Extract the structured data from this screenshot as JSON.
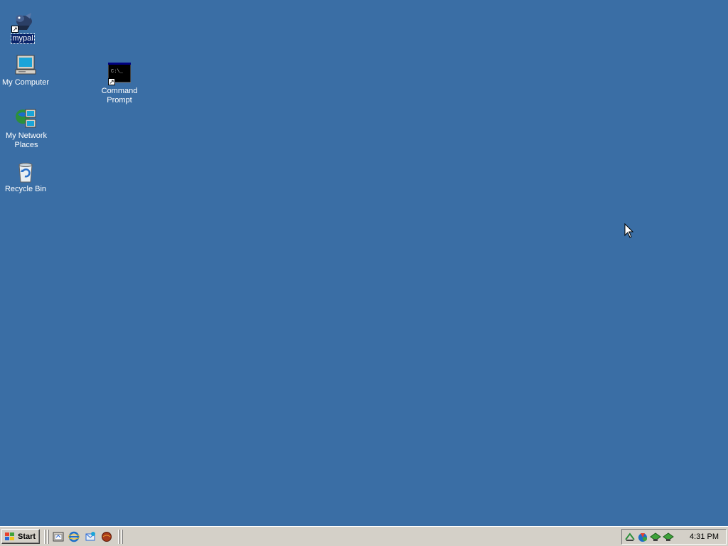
{
  "desktop": {
    "background": "#3a6ea5",
    "icons": [
      {
        "label": "mypal",
        "icon": "mypal-icon",
        "shortcut": true,
        "selected": true
      },
      {
        "label": "My Computer",
        "icon": "my-computer-icon",
        "shortcut": false
      },
      {
        "label": "My Network Places",
        "icon": "network-places-icon",
        "shortcut": false
      },
      {
        "label": "Recycle Bin",
        "icon": "recycle-bin-icon",
        "shortcut": false
      },
      {
        "label": "Command Prompt",
        "icon": "command-prompt-icon",
        "shortcut": true,
        "screen_text": "C:\\_"
      }
    ]
  },
  "taskbar": {
    "start_label": "Start",
    "quick_launch": [
      "show-desktop-icon",
      "internet-explorer-icon",
      "outlook-express-icon",
      "browser-icon"
    ],
    "tray_icons": [
      "network-tray-icon",
      "tray-app-icon",
      "network-connection-1-icon",
      "network-connection-2-icon"
    ],
    "clock": "4:31 PM"
  }
}
